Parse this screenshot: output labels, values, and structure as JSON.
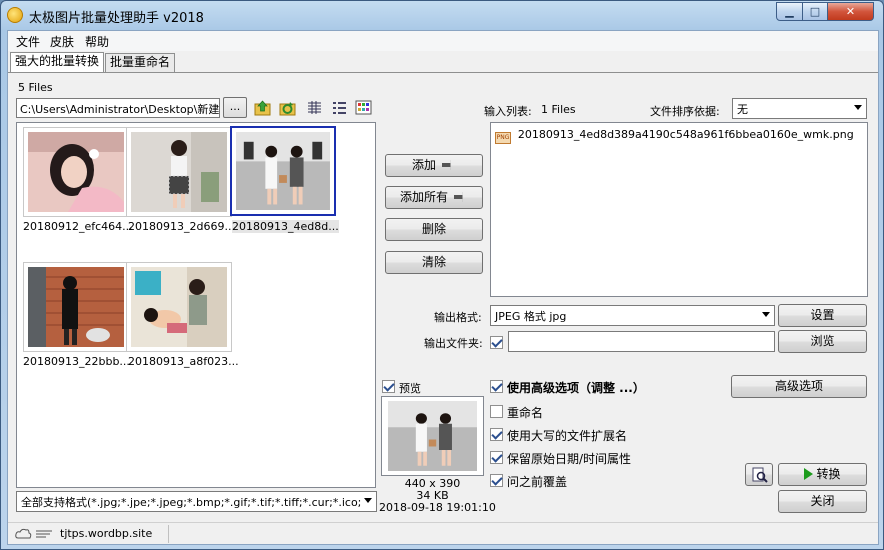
{
  "window": {
    "title": "太极图片批量处理助手  v2018",
    "controls": {
      "minimize": "▁",
      "maximize": "□",
      "close": "✕"
    }
  },
  "menu": [
    "文件",
    "皮肤",
    "帮助"
  ],
  "tabs": [
    "强大的批量转换",
    "批量重命名"
  ],
  "left": {
    "file_count": "5 Files",
    "path": "C:\\Users\\Administrator\\Desktop\\新建文件夹",
    "browse_label": "...",
    "files": [
      {
        "name": "20180912_efc464..."
      },
      {
        "name": "20180913_2d669..."
      },
      {
        "name": "20180913_4ed8d..."
      },
      {
        "name": "20180913_22bbb..."
      },
      {
        "name": "20180913_a8f023..."
      }
    ],
    "filter": "全部支持格式(*.jpg;*.jpe;*.jpeg;*.bmp;*.gif;*.tif;*.tiff;*.cur;*.ico;"
  },
  "middle": {
    "add": "添加",
    "add_all": "添加所有",
    "delete": "删除",
    "clear": "清除"
  },
  "right": {
    "input_list_label": "输入列表:",
    "input_count": "1 Files",
    "sort_label": "文件排序依据:",
    "sort_value": "无",
    "input_files": [
      "20180913_4ed8d389a4190c548a961f6bbea0160e_wmk.png"
    ],
    "file_badge": "PNG",
    "output_format_label": "输出格式:",
    "output_format": "JPEG 格式 jpg",
    "settings": "设置",
    "output_folder_label": "输出文件夹:",
    "output_folder": "",
    "browse": "浏览"
  },
  "preview": {
    "label": "预览",
    "size": "440 x 390",
    "filesize": "34 KB",
    "date": "2018-09-18 19:01:10"
  },
  "options": {
    "advanced": "使用高级选项（调整 ...）",
    "rename": "重命名",
    "uppercase_ext": "使用大写的文件扩展名",
    "keep_date": "保留原始日期/时间属性",
    "overwrite": "问之前覆盖",
    "advanced_btn": "高级选项",
    "convert": "转换",
    "close": "关闭"
  },
  "status": {
    "site": "tjtps.wordbp.site"
  }
}
